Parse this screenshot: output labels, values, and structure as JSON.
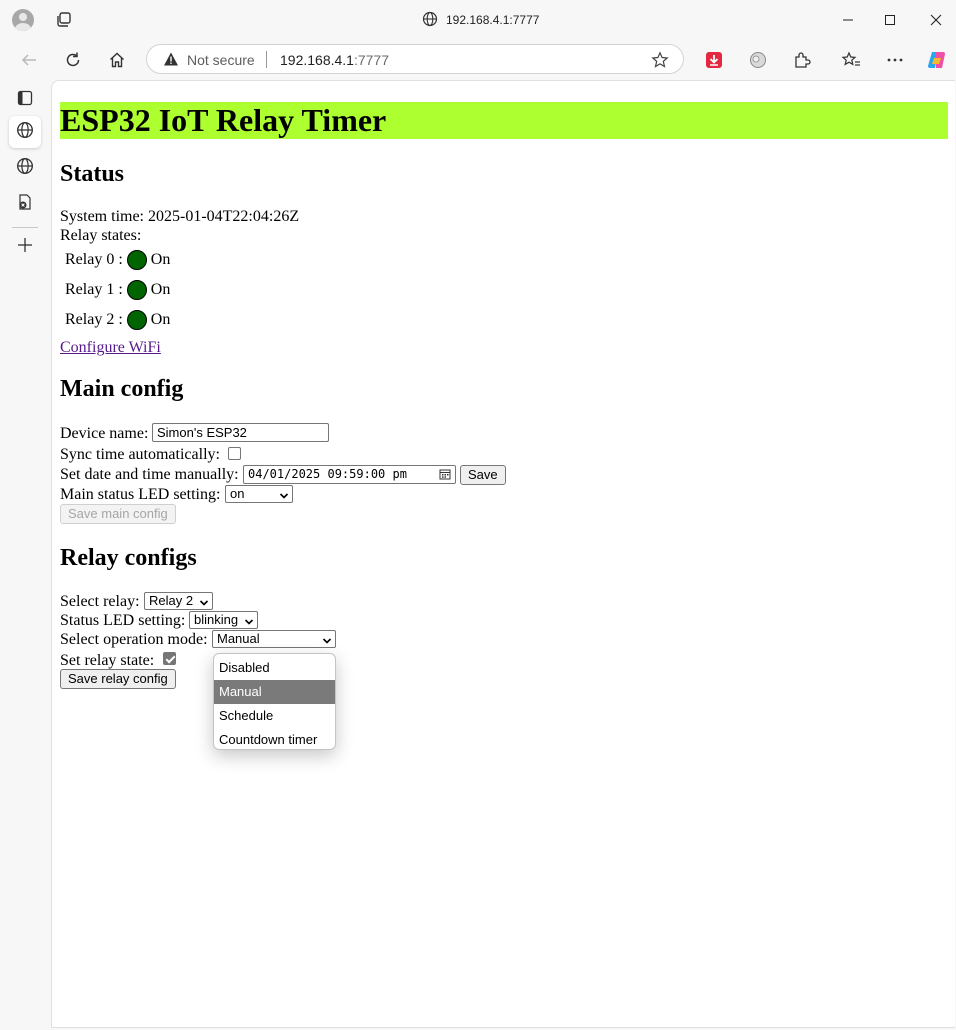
{
  "browser": {
    "window_title": "192.168.4.1:7777",
    "address": {
      "security_label": "Not secure",
      "host": "192.168.4.1",
      "port": ":7777"
    }
  },
  "page": {
    "title": "ESP32 IoT Relay Timer",
    "banner_color": "#adff2f",
    "status": {
      "heading": "Status",
      "system_time_label": "System time: ",
      "system_time_value": "2025-01-04T22:04:26Z",
      "relay_states_label": "Relay states:",
      "relays": [
        {
          "label": "Relay 0 :",
          "state": "On"
        },
        {
          "label": "Relay 1 :",
          "state": "On"
        },
        {
          "label": "Relay 2 :",
          "state": "On"
        }
      ],
      "led_on_color": "#006400",
      "configure_wifi_link": "Configure WiFi"
    },
    "main_config": {
      "heading": "Main config",
      "device_name_label": "Device name:",
      "device_name_value": "Simon's ESP32",
      "sync_time_label": "Sync time automatically:",
      "sync_time_checked": false,
      "set_datetime_label": "Set date and time manually:",
      "datetime_value": "04/01/2025 09:59:00 pm",
      "save_button": "Save",
      "status_led_label": "Main status LED setting:",
      "status_led_value": "on",
      "save_main_button": "Save main config"
    },
    "relay_configs": {
      "heading": "Relay configs",
      "select_relay_label": "Select relay:",
      "select_relay_value": "Relay 2",
      "status_led_label": "Status LED setting:",
      "status_led_value": "blinking",
      "operation_mode_label": "Select operation mode:",
      "operation_mode_value": "Manual",
      "operation_mode_options": [
        "Disabled",
        "Manual",
        "Schedule",
        "Countdown timer"
      ],
      "operation_mode_selected_index": 1,
      "set_relay_state_label": "Set relay state:",
      "set_relay_state_checked": true,
      "save_relay_button": "Save relay config"
    }
  }
}
